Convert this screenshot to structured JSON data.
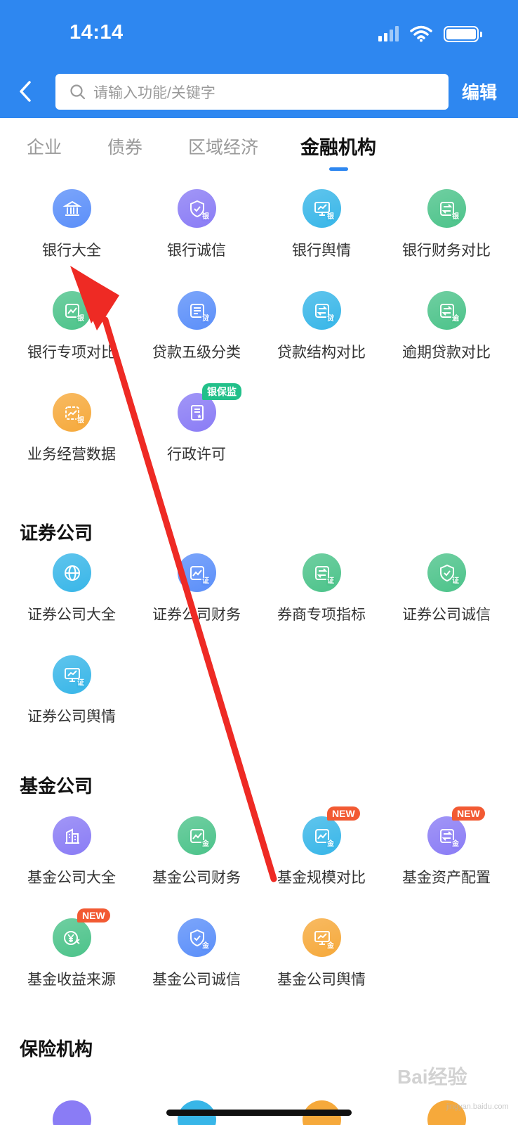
{
  "status_bar": {
    "time": "14:14"
  },
  "header": {
    "search_placeholder": "请输入功能/关键字",
    "edit_label": "编辑"
  },
  "tabs": [
    {
      "label": "企业"
    },
    {
      "label": "债券"
    },
    {
      "label": "区域经济"
    },
    {
      "label": "金融机构"
    }
  ],
  "bank_section": {
    "items": [
      {
        "label": "银行大全",
        "icon": "bank-icon",
        "color": "#5b8ff9"
      },
      {
        "label": "银行诚信",
        "icon": "shield-check-icon",
        "color": "#8a7cf5",
        "sub": "银"
      },
      {
        "label": "银行舆情",
        "icon": "chart-screen-icon",
        "color": "#38b6e8",
        "sub": "银"
      },
      {
        "label": "银行财务对比",
        "icon": "exchange-icon",
        "color": "#4cc38a",
        "sub": "银"
      },
      {
        "label": "银行专项对比",
        "icon": "trend-icon",
        "color": "#4cc38a",
        "sub": "银"
      },
      {
        "label": "贷款五级分类",
        "icon": "list-icon",
        "color": "#5b8ff9",
        "sub": "贷"
      },
      {
        "label": "贷款结构对比",
        "icon": "exchange-icon",
        "color": "#38b6e8",
        "sub": "贷"
      },
      {
        "label": "逾期贷款对比",
        "icon": "exchange-icon",
        "color": "#4cc38a",
        "sub": "逾"
      },
      {
        "label": "业务经营数据",
        "icon": "calendar-chart-icon",
        "color": "#f6a93b",
        "sub": "银"
      },
      {
        "label": "行政许可",
        "icon": "document-star-icon",
        "color": "#8a7cf5",
        "badge": "银保监"
      }
    ]
  },
  "securities_section": {
    "title": "证券公司",
    "items": [
      {
        "label": "证券公司大全",
        "icon": "globe-icon",
        "color": "#38b6e8"
      },
      {
        "label": "证券公司财务",
        "icon": "trend-icon",
        "color": "#5b8ff9",
        "sub": "证"
      },
      {
        "label": "券商专项指标",
        "icon": "exchange-icon",
        "color": "#4cc38a",
        "sub": "证"
      },
      {
        "label": "证券公司诚信",
        "icon": "shield-check-icon",
        "color": "#4cc38a",
        "sub": "证"
      },
      {
        "label": "证券公司舆情",
        "icon": "chart-screen-icon",
        "color": "#38b6e8",
        "sub": "证"
      }
    ]
  },
  "fund_section": {
    "title": "基金公司",
    "items": [
      {
        "label": "基金公司大全",
        "icon": "building-icon",
        "color": "#8a7cf5"
      },
      {
        "label": "基金公司财务",
        "icon": "trend-icon",
        "color": "#4cc38a",
        "sub": "金"
      },
      {
        "label": "基金规模对比",
        "icon": "trend-icon",
        "color": "#38b6e8",
        "sub": "金",
        "badge": "NEW"
      },
      {
        "label": "基金资产配置",
        "icon": "exchange-icon",
        "color": "#8a7cf5",
        "sub": "金",
        "badge": "NEW"
      },
      {
        "label": "基金收益来源",
        "icon": "yuan-icon",
        "color": "#4cc38a",
        "badge": "NEW"
      },
      {
        "label": "基金公司诚信",
        "icon": "shield-check-icon",
        "color": "#5b8ff9",
        "sub": "金"
      },
      {
        "label": "基金公司舆情",
        "icon": "chart-screen-icon",
        "color": "#f6a93b",
        "sub": "金"
      }
    ]
  },
  "insurance_section": {
    "title": "保险机构"
  },
  "watermark": {
    "text": "Bai经验",
    "sub": "jingyan.baidu.com"
  }
}
